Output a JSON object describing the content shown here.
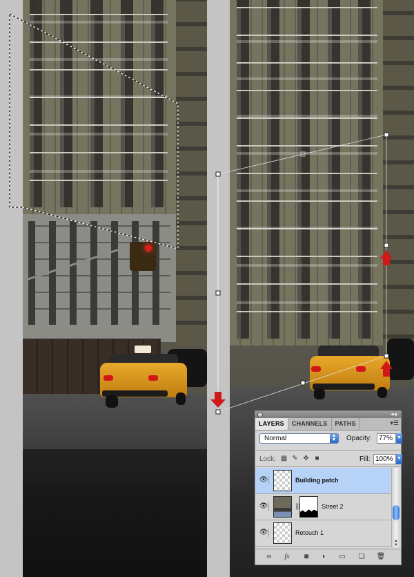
{
  "panel": {
    "tabs": [
      {
        "label": "LAYERS",
        "active": true
      },
      {
        "label": "CHANNELS",
        "active": false
      },
      {
        "label": "PATHS",
        "active": false
      }
    ],
    "blend_mode": "Normal",
    "opacity_label": "Opacity:",
    "opacity_value": "77%",
    "lock_label": "Lock:",
    "fill_label": "Fill:",
    "fill_value": "100%",
    "layers": [
      {
        "name": "Building patch",
        "selected": true,
        "visible": true,
        "thumbnail": "transparent"
      },
      {
        "name": "Street 2",
        "selected": false,
        "visible": true,
        "thumbnail": "photo",
        "has_mask": true
      },
      {
        "name": "Retouch 1",
        "selected": false,
        "visible": true,
        "thumbnail": "transparent"
      }
    ],
    "bottom_icons": [
      "link-layers-icon",
      "fx-icon",
      "add-mask-icon",
      "adjustment-layer-icon",
      "new-group-icon",
      "new-layer-icon",
      "trash-icon"
    ]
  },
  "colors": {
    "selected_layer": "#b6d3f7",
    "arrow_red": "#d01a1a",
    "canvas_gap": "#c4c4c4"
  }
}
